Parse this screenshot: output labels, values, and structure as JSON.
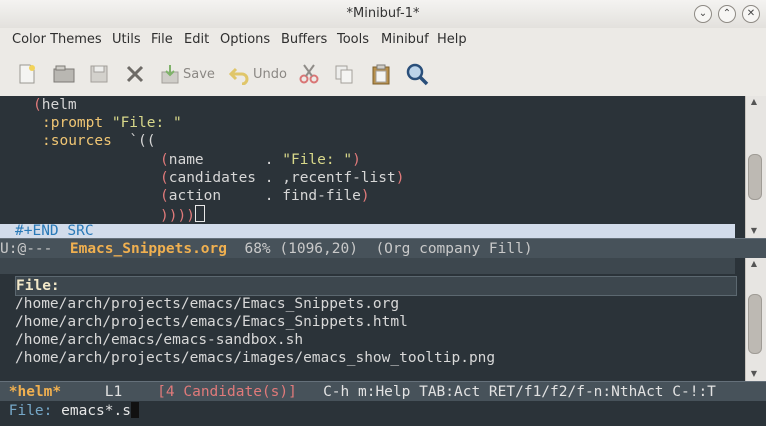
{
  "window": {
    "title": "*Minibuf-1*"
  },
  "menubar": {
    "items": [
      "Color Themes",
      "Utils",
      "File",
      "Edit",
      "Options",
      "Buffers",
      "Tools",
      "Minibuf",
      "Help"
    ]
  },
  "toolbar": {
    "save_label": "Save",
    "undo_label": "Undo"
  },
  "editor": {
    "lines": [
      {
        "parts": [
          "(",
          "helm"
        ]
      },
      {
        "parts": [
          ":prompt",
          "\"File: \""
        ]
      },
      {
        "parts": [
          ":sources",
          "`(("
        ]
      },
      {
        "parts": [
          "(",
          "name",
          ".",
          "\"File: \"",
          ")"
        ]
      },
      {
        "parts": [
          "(",
          "candidates",
          ". ,recentf-list",
          ")"
        ]
      },
      {
        "parts": [
          "(",
          "action",
          ". find-file",
          ")"
        ]
      },
      {
        "parts": [
          ")))",
          ")"
        ]
      }
    ],
    "end_src": "#+END_SRC"
  },
  "modeline": {
    "state": "U:@---",
    "buffer": "Emacs_Snippets.org",
    "position": "68% (1096,20)",
    "modes": "(Org company Fill)"
  },
  "helm": {
    "header": "File:",
    "candidates": [
      "/home/arch/projects/emacs/Emacs_Snippets.org",
      "/home/arch/projects/emacs/Emacs_Snippets.html",
      "/home/arch/emacs/emacs-sandbox.sh",
      "/home/arch/projects/emacs/images/emacs_show_tooltip.png"
    ],
    "modeline": {
      "name": "*helm*",
      "line": "L1",
      "count": "[4 Candidate(s)]",
      "help": "C-h m:Help TAB:Act RET/f1/f2/f-n:NthAct C-!:T"
    }
  },
  "minibuffer": {
    "prompt": "File: ",
    "input": "emacs*.s"
  },
  "icons": [
    "new-file-icon",
    "open-folder-icon",
    "save-disk-icon",
    "close-x-icon",
    "save-icon",
    "undo-icon",
    "cut-icon",
    "copy-icon",
    "paste-icon",
    "search-icon"
  ]
}
